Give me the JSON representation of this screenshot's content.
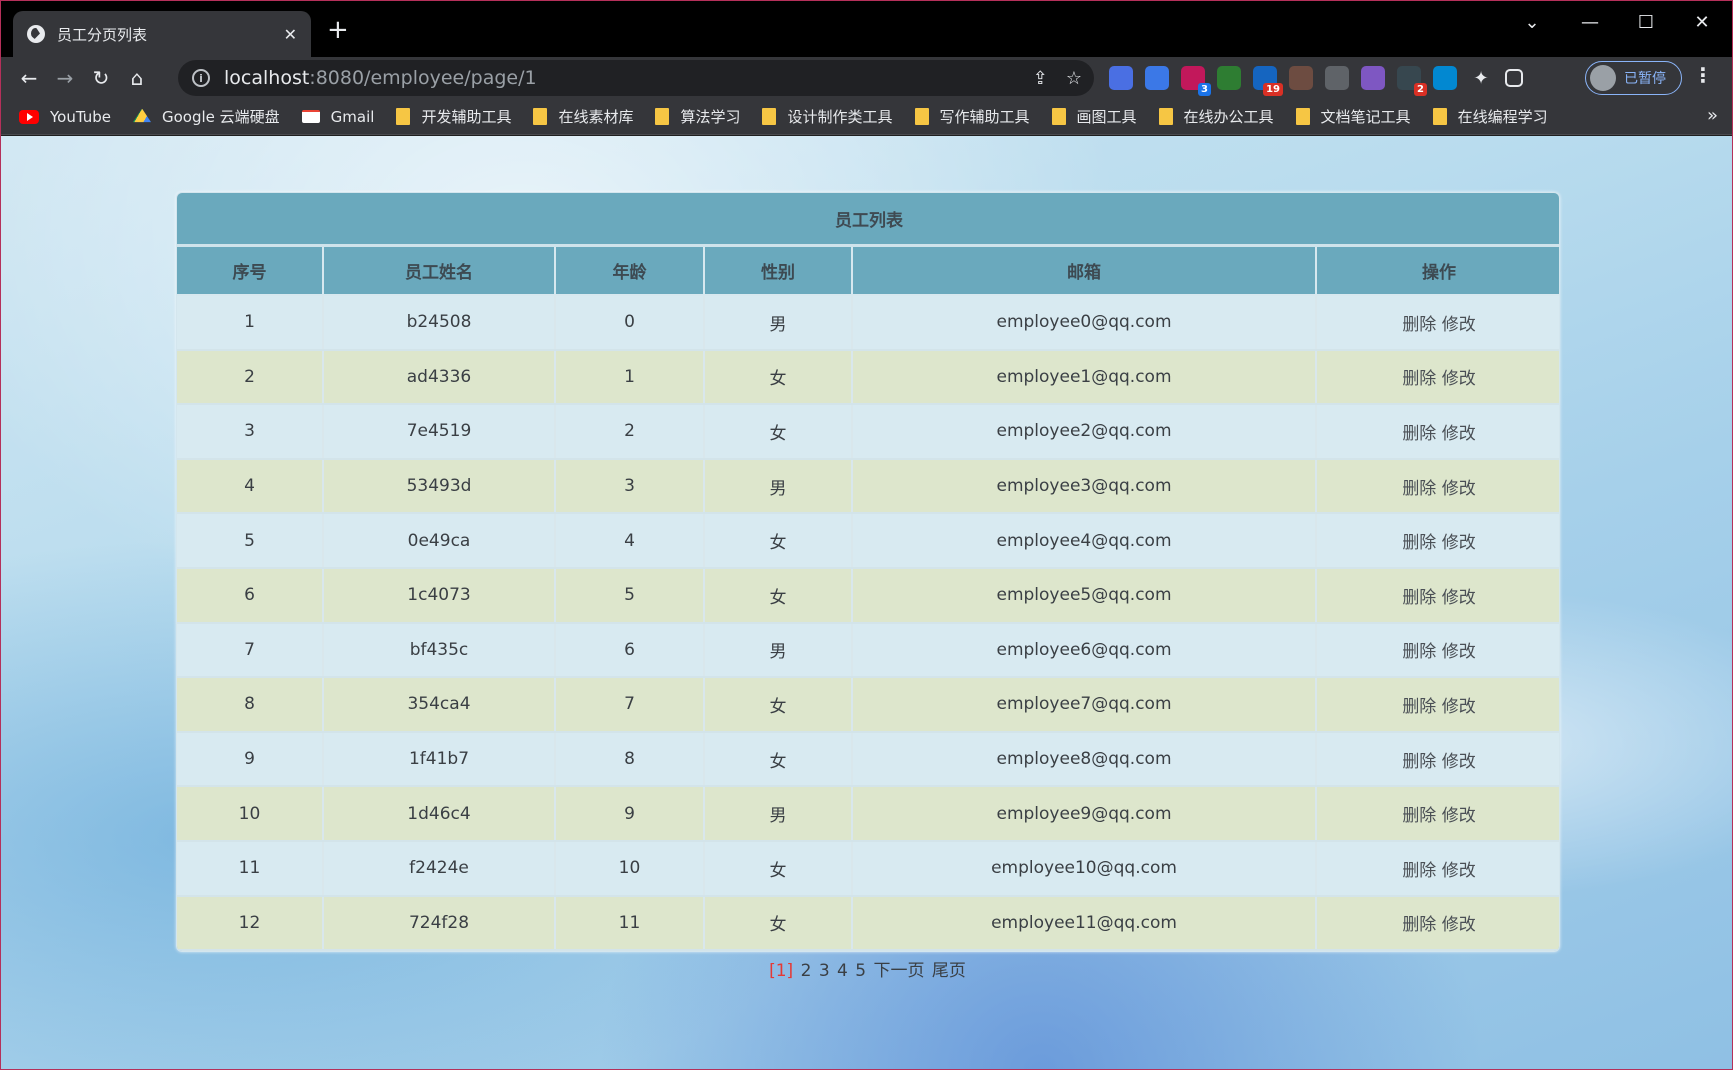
{
  "browser": {
    "tab_title": "员工分页列表",
    "tab_close": "✕",
    "new_tab": "+",
    "url_host": "localhost",
    "url_rest": ":8080/employee/page/1",
    "profile_label": "已暂停",
    "extensions": [
      {
        "name": "ext-1",
        "color": "#4a6fe3",
        "badge": ""
      },
      {
        "name": "ext-translate",
        "color": "#3b78e7",
        "badge": ""
      },
      {
        "name": "ext-cat",
        "color": "#c2185b",
        "badge": "3",
        "badge_color": "blue"
      },
      {
        "name": "ext-download",
        "color": "#2e7d32",
        "badge": ""
      },
      {
        "name": "ext-apps",
        "color": "#1565c0",
        "badge": "19"
      },
      {
        "name": "ext-owl",
        "color": "#6d4c41",
        "badge": ""
      },
      {
        "name": "ext-cursor",
        "color": "#5f6368",
        "badge": ""
      },
      {
        "name": "ext-screen",
        "color": "#7e57c2",
        "badge": ""
      },
      {
        "name": "ext-mask",
        "color": "#37474f",
        "badge": "2"
      },
      {
        "name": "ext-m",
        "color": "#0288d1",
        "badge": ""
      }
    ]
  },
  "bookmarks": [
    {
      "label": "YouTube",
      "icon": "youtube-icon"
    },
    {
      "label": "Google 云端硬盘",
      "icon": "drive-icon"
    },
    {
      "label": "Gmail",
      "icon": "gmail-icon"
    },
    {
      "label": "开发辅助工具",
      "icon": "folder-icon"
    },
    {
      "label": "在线素材库",
      "icon": "folder-icon"
    },
    {
      "label": "算法学习",
      "icon": "folder-icon"
    },
    {
      "label": "设计制作类工具",
      "icon": "folder-icon"
    },
    {
      "label": "写作辅助工具",
      "icon": "folder-icon"
    },
    {
      "label": "画图工具",
      "icon": "folder-icon"
    },
    {
      "label": "在线办公工具",
      "icon": "folder-icon"
    },
    {
      "label": "文档笔记工具",
      "icon": "folder-icon"
    },
    {
      "label": "在线编程学习",
      "icon": "folder-icon"
    }
  ],
  "table": {
    "caption": "员工列表",
    "headers": [
      "序号",
      "员工姓名",
      "年龄",
      "性别",
      "邮箱",
      "操作"
    ],
    "rows": [
      [
        "1",
        "b24508",
        "0",
        "男",
        "employee0@qq.com"
      ],
      [
        "2",
        "ad4336",
        "1",
        "女",
        "employee1@qq.com"
      ],
      [
        "3",
        "7e4519",
        "2",
        "女",
        "employee2@qq.com"
      ],
      [
        "4",
        "53493d",
        "3",
        "男",
        "employee3@qq.com"
      ],
      [
        "5",
        "0e49ca",
        "4",
        "女",
        "employee4@qq.com"
      ],
      [
        "6",
        "1c4073",
        "5",
        "女",
        "employee5@qq.com"
      ],
      [
        "7",
        "bf435c",
        "6",
        "男",
        "employee6@qq.com"
      ],
      [
        "8",
        "354ca4",
        "7",
        "女",
        "employee7@qq.com"
      ],
      [
        "9",
        "1f41b7",
        "8",
        "女",
        "employee8@qq.com"
      ],
      [
        "10",
        "1d46c4",
        "9",
        "男",
        "employee9@qq.com"
      ],
      [
        "11",
        "f2424e",
        "10",
        "女",
        "employee10@qq.com"
      ],
      [
        "12",
        "724f28",
        "11",
        "女",
        "employee11@qq.com"
      ]
    ],
    "delete_label": "删除",
    "edit_label": "修改"
  },
  "pager": {
    "current": "[1]",
    "pages": [
      "2",
      "3",
      "4",
      "5"
    ],
    "next_label": "下一页",
    "last_label": "尾页"
  }
}
